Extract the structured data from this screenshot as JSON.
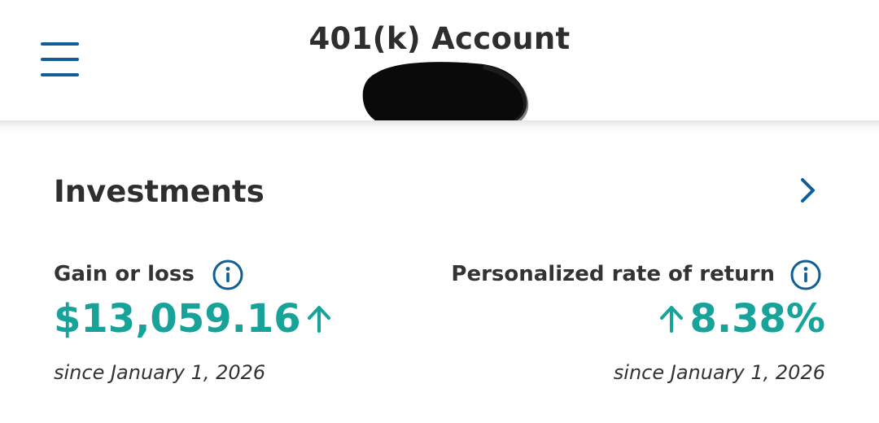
{
  "header": {
    "title": "401(k) Account",
    "menu_icon": "hamburger-menu-icon",
    "accent_color": "#0f5f95"
  },
  "investments": {
    "title": "Investments",
    "chevron_icon": "chevron-right-icon",
    "gain_or_loss": {
      "label": "Gain or loss",
      "value": "$13,059.16",
      "direction": "up",
      "since": "since January 1, 2026",
      "info_icon": "info-icon"
    },
    "rate_of_return": {
      "label": "Personalized rate of return",
      "value": "8.38%",
      "direction": "up",
      "since": "since January 1, 2026",
      "info_icon": "info-icon"
    },
    "positive_color": "#17a29a"
  }
}
